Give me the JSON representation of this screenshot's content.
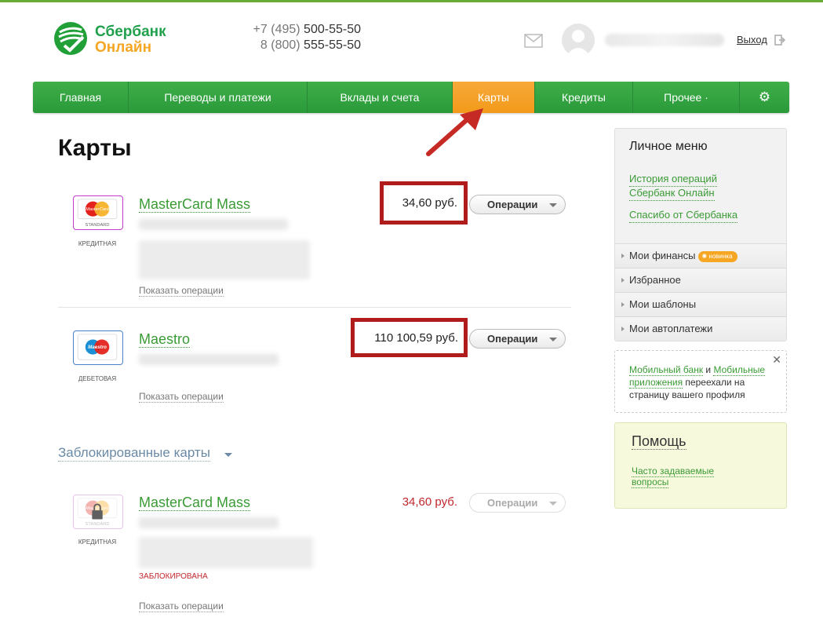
{
  "header": {
    "logo_line1": "Сбербанк",
    "logo_line2": "Онлайн",
    "phone1_code": "+7 (495)",
    "phone1_number": "500-55-50",
    "phone2_code": "8 (800)",
    "phone2_number": "555-55-50",
    "logout_label": "Выход"
  },
  "nav": {
    "items": [
      "Главная",
      "Переводы и платежи",
      "Вклады и счета",
      "Карты",
      "Кредиты",
      "Прочее ·"
    ],
    "active": "Карты"
  },
  "main": {
    "title": "Карты",
    "cards": [
      {
        "name": "MasterCard Mass",
        "type": "кредитная",
        "brand": "MasterCard",
        "brand_sub": "STANDARD",
        "amount": "34,60 руб.",
        "ops_label": "Операции",
        "show_ops": "Показать операции"
      },
      {
        "name": "Maestro",
        "type": "дебетовая",
        "brand": "Maestro",
        "amount": "110 100,59 руб.",
        "ops_label": "Операции",
        "show_ops": "Показать операции"
      }
    ],
    "blocked_heading": "Заблокированные карты",
    "blocked_card": {
      "name": "MasterCard Mass",
      "type": "кредитная",
      "brand": "MasterCard",
      "brand_sub": "STANDARD",
      "amount": "34,60 руб.",
      "ops_label": "Операции",
      "status": "ЗАБЛОКИРОВАНА",
      "show_ops": "Показать операции"
    }
  },
  "sidebar": {
    "title": "Личное меню",
    "link1_line1": "История операций",
    "link1_line2": "Сбербанк Онлайн",
    "link2": "Спасибо от Сбербанка",
    "items": [
      "Мои финансы",
      "Избранное",
      "Мои шаблоны",
      "Мои автоплатежи"
    ],
    "new_badge": "новинка",
    "note_link1": "Мобильный банк",
    "note_and": " и ",
    "note_link2": "Мобильные приложения",
    "note_text": " переехали на страницу вашего профиля",
    "help_title": "Помощь",
    "help_link_line1": "Часто задаваемые",
    "help_link_line2": "вопросы"
  },
  "colors": {
    "brand_green": "#2a9a3a",
    "active_orange": "#f29a1a",
    "highlight_red": "#b01b1b"
  }
}
